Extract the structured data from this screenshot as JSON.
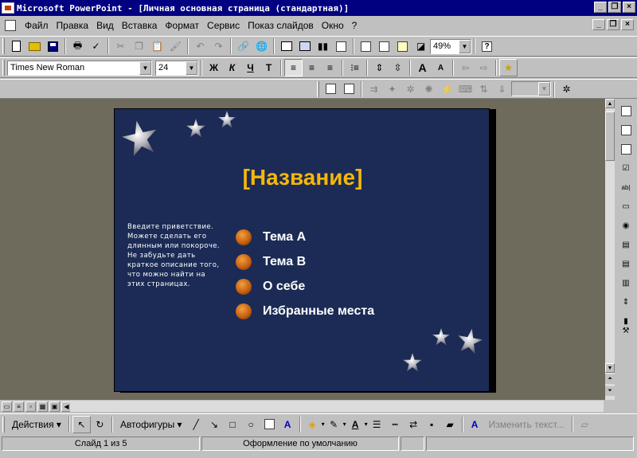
{
  "window": {
    "title": "Microsoft PowerPoint - [Личная основная страница (стандартная)]",
    "caption_buttons": [
      "_",
      "❐",
      "×"
    ]
  },
  "menubar": {
    "items": [
      "Файл",
      "Правка",
      "Вид",
      "Вставка",
      "Формат",
      "Сервис",
      "Показ слайдов",
      "Окно",
      "?"
    ],
    "caption_buttons": [
      "_",
      "❐",
      "×"
    ]
  },
  "standard_toolbar": {
    "zoom": "49%"
  },
  "format_toolbar": {
    "font_name": "Times New Roman",
    "font_size": "24",
    "bold": "Ж",
    "italic": "К",
    "underline": "Ч",
    "shadow": "Т"
  },
  "slide": {
    "title": "[Название]",
    "intro_text": "Введите приветствие. Можете сделать его длинным или покороче. Не забудьте дать краткое описание того, что можно найти на этих страницах.",
    "items": [
      "Тема A",
      "Тема B",
      "О себе",
      "Избранные места"
    ],
    "background": "#1b2b55",
    "title_color": "#f5b70a"
  },
  "drawing_toolbar": {
    "actions": "Действия",
    "autoshapes": "Автофигуры",
    "edit_text": "Изменить текст..."
  },
  "statusbar": {
    "slide_info": "Слайд 1 из 5",
    "design": "Оформление по умолчанию"
  },
  "colors": {
    "titlebar": "#000080",
    "face": "#c0c0c0",
    "workspace": "#6e6a5c"
  }
}
